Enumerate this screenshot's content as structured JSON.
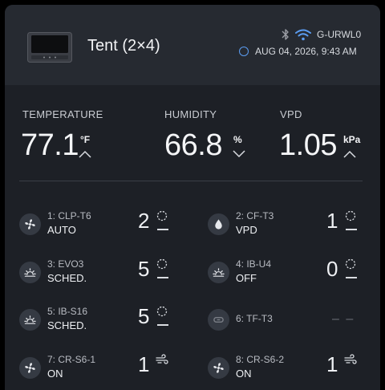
{
  "header": {
    "title": "Tent (2×4)",
    "device_name": "G-URWL0",
    "timestamp": "AUG 04, 2026, 9:43 AM"
  },
  "metrics": [
    {
      "label": "TEMPERATURE",
      "value": "77.1",
      "unit": "°F",
      "trend": "up"
    },
    {
      "label": "HUMIDITY",
      "value": "66.8",
      "unit": "%",
      "trend": "down"
    },
    {
      "label": "VPD",
      "value": "1.05",
      "unit": "kPa",
      "trend": "up"
    }
  ],
  "ports": [
    {
      "name": "1: CLP-T6",
      "mode": "AUTO",
      "level": "2",
      "icon": "fan-icon",
      "status_icon": "timer-dial-icon"
    },
    {
      "name": "2: CF-T3",
      "mode": "VPD",
      "level": "1",
      "icon": "water-drop-icon",
      "status_icon": "timer-dial-icon"
    },
    {
      "name": "3: EVO3",
      "mode": "SCHED.",
      "level": "5",
      "icon": "sunrise-icon",
      "status_icon": "timer-dial-icon"
    },
    {
      "name": "4: IB-U4",
      "mode": "OFF",
      "level": "0",
      "icon": "sunrise-icon",
      "status_icon": "timer-dial-icon"
    },
    {
      "name": "5: IB-S16",
      "mode": "SCHED.",
      "level": "5",
      "icon": "sunrise-icon",
      "status_icon": "timer-dial-icon"
    },
    {
      "name": "6: TF-T3",
      "mode": "",
      "level": "– –",
      "icon": "disconnected-icon",
      "status_icon": ""
    },
    {
      "name": "7: CR-S6-1",
      "mode": "ON",
      "level": "1",
      "icon": "fan-icon",
      "status_icon": "wind-icon"
    },
    {
      "name": "8: CR-S6-2",
      "mode": "ON",
      "level": "1",
      "icon": "fan-icon",
      "status_icon": "wind-icon"
    }
  ],
  "colors": {
    "background": "#1d2026",
    "header": "#262a31",
    "accent_blue": "#5b9cf0",
    "icon_bg": "#353a43"
  }
}
